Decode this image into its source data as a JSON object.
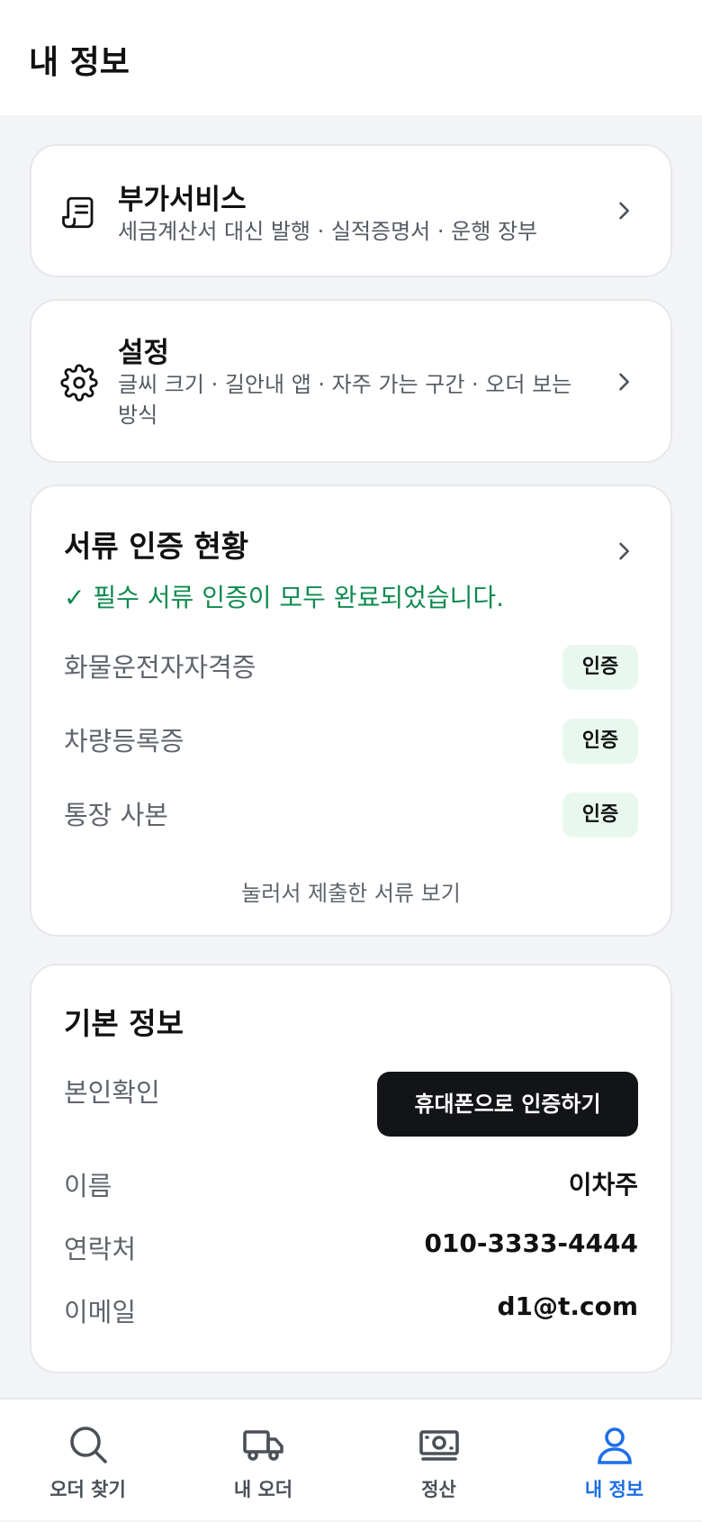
{
  "header": {
    "title": "내 정보"
  },
  "menu": {
    "extra_services": {
      "title": "부가서비스",
      "desc": "세금계산서 대신 발행 · 실적증명서 · 운행 장부",
      "icon": "receipt-icon"
    },
    "settings": {
      "title": "설정",
      "desc": "글씨 크기 · 길안내 앱 · 자주 가는 구간 · 오더 보는 방식",
      "icon": "gear-icon"
    }
  },
  "documents": {
    "title": "서류 인증 현황",
    "status": "✓ 필수 서류 인증이 모두 완료되었습니다.",
    "items": [
      {
        "label": "화물운전자자격증",
        "badge": "인증"
      },
      {
        "label": "차량등록증",
        "badge": "인증"
      },
      {
        "label": "통장 사본",
        "badge": "인증"
      }
    ],
    "view_link": "눌러서 제출한 서류 보기"
  },
  "basic_info": {
    "title": "기본 정보",
    "verify_label": "본인확인",
    "verify_button": "휴대폰으로 인증하기",
    "name_label": "이름",
    "name_value": "이차주",
    "phone_label": "연락처",
    "phone_value": "010-3333-4444",
    "email_label": "이메일",
    "email_value": "d1@t.com"
  },
  "nav": {
    "items": [
      {
        "label": "오더 찾기",
        "icon": "search-icon"
      },
      {
        "label": "내 오더",
        "icon": "truck-icon"
      },
      {
        "label": "정산",
        "icon": "cash-icon"
      },
      {
        "label": "내 정보",
        "icon": "user-icon"
      }
    ],
    "active_index": 3
  },
  "colors": {
    "accent": "#1d6fe6",
    "success": "#0f8a4f",
    "badge_bg": "#e9f8ef",
    "button_dark": "#121418",
    "background": "#f3f4f6"
  }
}
